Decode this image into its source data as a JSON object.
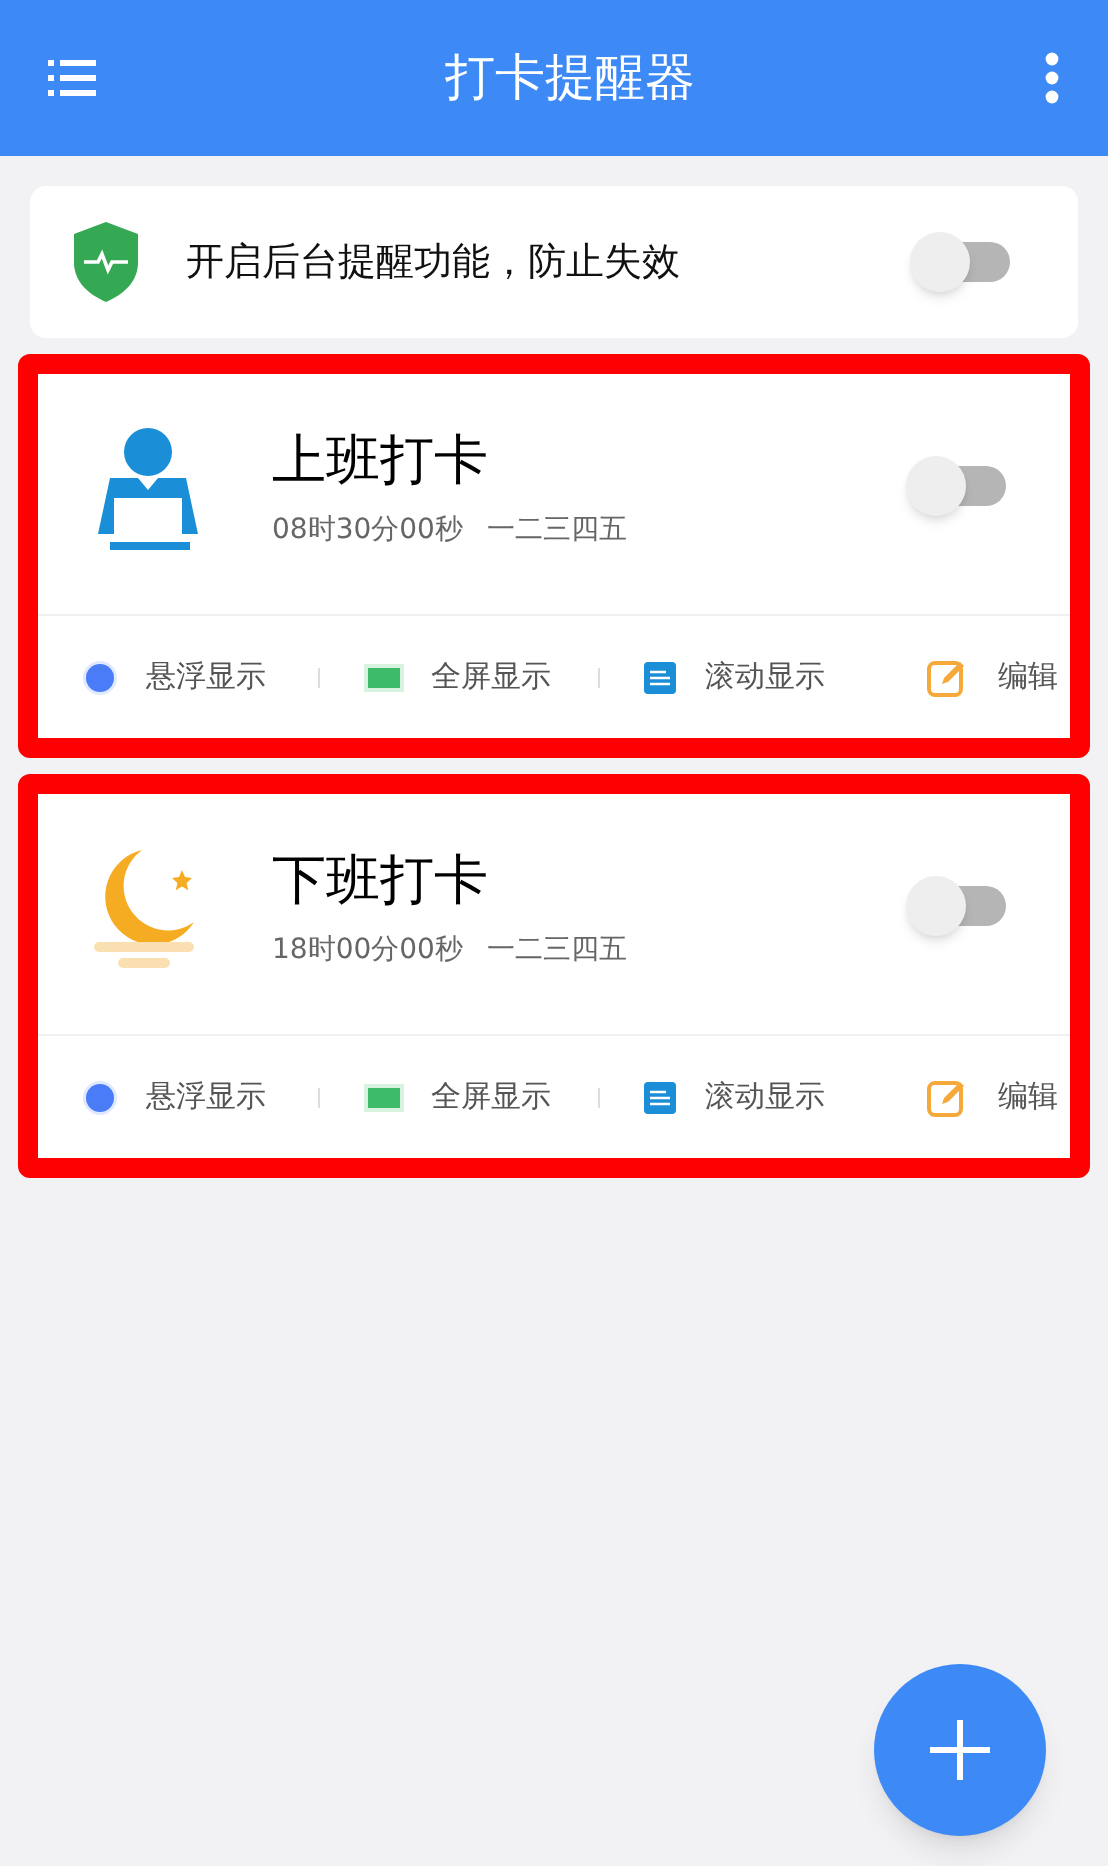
{
  "app_bar": {
    "title": "打卡提醒器"
  },
  "background_card": {
    "text": "开启后台提醒功能，防止失效",
    "on": false
  },
  "reminders": [
    {
      "kind": "work",
      "title": "上班打卡",
      "time": "08时30分00秒",
      "days": "一二三四五",
      "on": false,
      "actions": [
        {
          "kind": "float",
          "label": "悬浮显示"
        },
        {
          "kind": "fullscreen",
          "label": "全屏显示"
        },
        {
          "kind": "scroll",
          "label": "滚动显示"
        },
        {
          "kind": "edit",
          "label": "编辑"
        }
      ]
    },
    {
      "kind": "night",
      "title": "下班打卡",
      "time": "18时00分00秒",
      "days": "一二三四五",
      "on": false,
      "actions": [
        {
          "kind": "float",
          "label": "悬浮显示"
        },
        {
          "kind": "fullscreen",
          "label": "全屏显示"
        },
        {
          "kind": "scroll",
          "label": "滚动显示"
        },
        {
          "kind": "edit",
          "label": "编辑"
        }
      ]
    }
  ]
}
